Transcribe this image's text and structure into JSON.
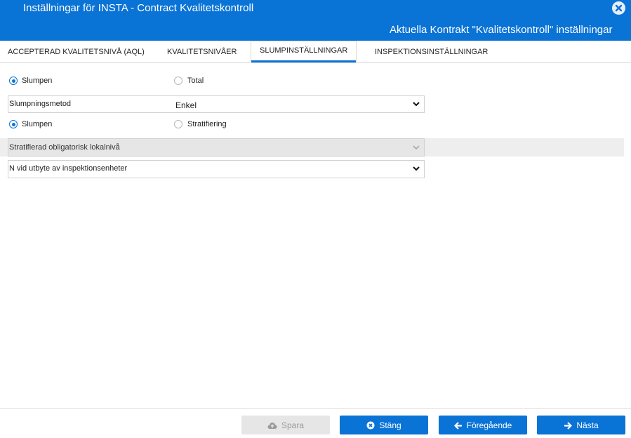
{
  "window": {
    "title": "Inställningar för INSTA - Contract Kvalitetskontroll",
    "subtitle": "Aktuella Kontrakt \"Kvalitetskontroll\" inställningar"
  },
  "tabs": [
    {
      "label": "ACCEPTERAD KVALITETSNIVÅ (AQL)",
      "active": false
    },
    {
      "label": "KVALITETSNIVÅER",
      "active": false
    },
    {
      "label": "SLUMPINSTÄLLNINGAR",
      "active": true
    },
    {
      "label": "INSPEKTIONSINSTÄLLNINGAR",
      "active": false
    }
  ],
  "sampling_scope": {
    "options": [
      "Slumpen",
      "Total"
    ],
    "selected": "Slumpen"
  },
  "sampling_method": {
    "label": "Slumpningsmetod",
    "value": "Enkel"
  },
  "sampling_type": {
    "options": [
      "Slumpen",
      "Stratifiering"
    ],
    "selected": "Slumpen"
  },
  "stratified_level": {
    "label": "Stratifierad obligatorisk lokalnivå",
    "value": "",
    "disabled": true
  },
  "n_exchange": {
    "label": "N vid utbyte av inspektionsenheter",
    "value": ""
  },
  "footer": {
    "save": "Spara",
    "close": "Stäng",
    "previous": "Föregående",
    "next": "Nästa"
  },
  "colors": {
    "accent": "#0a73d6",
    "disabled_bg": "#e6e6e6",
    "disabled_text": "#9b9b9b"
  }
}
